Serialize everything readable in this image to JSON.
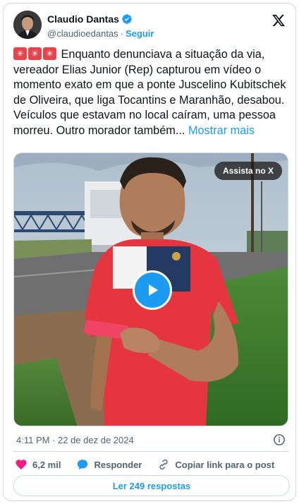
{
  "author": {
    "name": "Claudio Dantas",
    "handle": "@claudioedantas",
    "separator": "·",
    "follow_label": "Seguir",
    "verified": true
  },
  "tweet": {
    "emoji_prefix": [
      "siren-emoji",
      "siren-emoji",
      "siren-emoji"
    ],
    "text": "Enquanto denunciava a situação da via, vereador Elias Junior (Rep) capturou em vídeo o momento exato em que a ponte Juscelino Kubitschek de Oliveira, que liga Tocantins e Maranhão, desabou. Veículos que estavam no local caíram, uma pessoa morreu. Outro morador também...",
    "show_more": "Mostrar mais"
  },
  "media": {
    "type": "video",
    "watch_badge": "Assista no X",
    "play_icon": "play-icon"
  },
  "meta": {
    "timestamp": "4:11 PM · 22 de dez de 2024"
  },
  "actions": {
    "likes": "6,2 mil",
    "reply": "Responder",
    "copy_link": "Copiar link para o post"
  },
  "replies_button": "Ler 249 respostas",
  "colors": {
    "accent": "#1d9bf0",
    "like": "#f91880",
    "text": "#0f1419",
    "muted": "#536471",
    "border": "#cfd9de"
  }
}
